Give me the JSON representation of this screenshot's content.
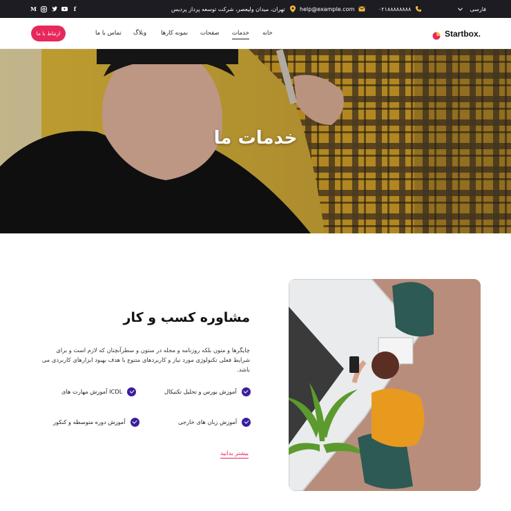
{
  "topbar": {
    "language": "فارسی",
    "phone": "۰۲۱۸۸۸۸۸۸۸۸",
    "email": "help@example.com",
    "address": "تهران، میدان ولیعصر، شرکت توسعه پرداز پردیس",
    "socials": [
      "facebook-icon",
      "twitter-icon",
      "youtube-icon",
      "instagram-icon",
      "medium-icon"
    ]
  },
  "header": {
    "logo": "Startbox.",
    "nav": [
      "خانه",
      "خدمات",
      "صفحات",
      "نمونه کارها",
      "وبلاگ",
      "تماس با ما"
    ],
    "active_nav": "خدمات",
    "cta": "ارتباط با ما"
  },
  "hero": {
    "title": "خدمات ما"
  },
  "section": {
    "title": "مشاوره کسب و کار",
    "text": "چایگرها و متون بلکه روزنامه و مجله در ستون و سطرآنچنان که لازم است و برای شرایط فعلی تکنولوژی مورد نیاز و کاربردهای متنوع با هدف بهبود ابزارهای کاربردی می باشد.",
    "features": [
      "آموزش بورس و تحلیل تکنیکال",
      "آموزش مهارت های ICDL",
      "آموزش زبان های خارجی",
      "آموزش دوره متوسطه و کنکور"
    ],
    "more_link": "بیشتر بدانید"
  },
  "colors": {
    "topbar_bg": "#1c1c22",
    "accent": "#e8285d",
    "check": "#3b1d9e",
    "icon_yellow": "#f6b93b"
  }
}
